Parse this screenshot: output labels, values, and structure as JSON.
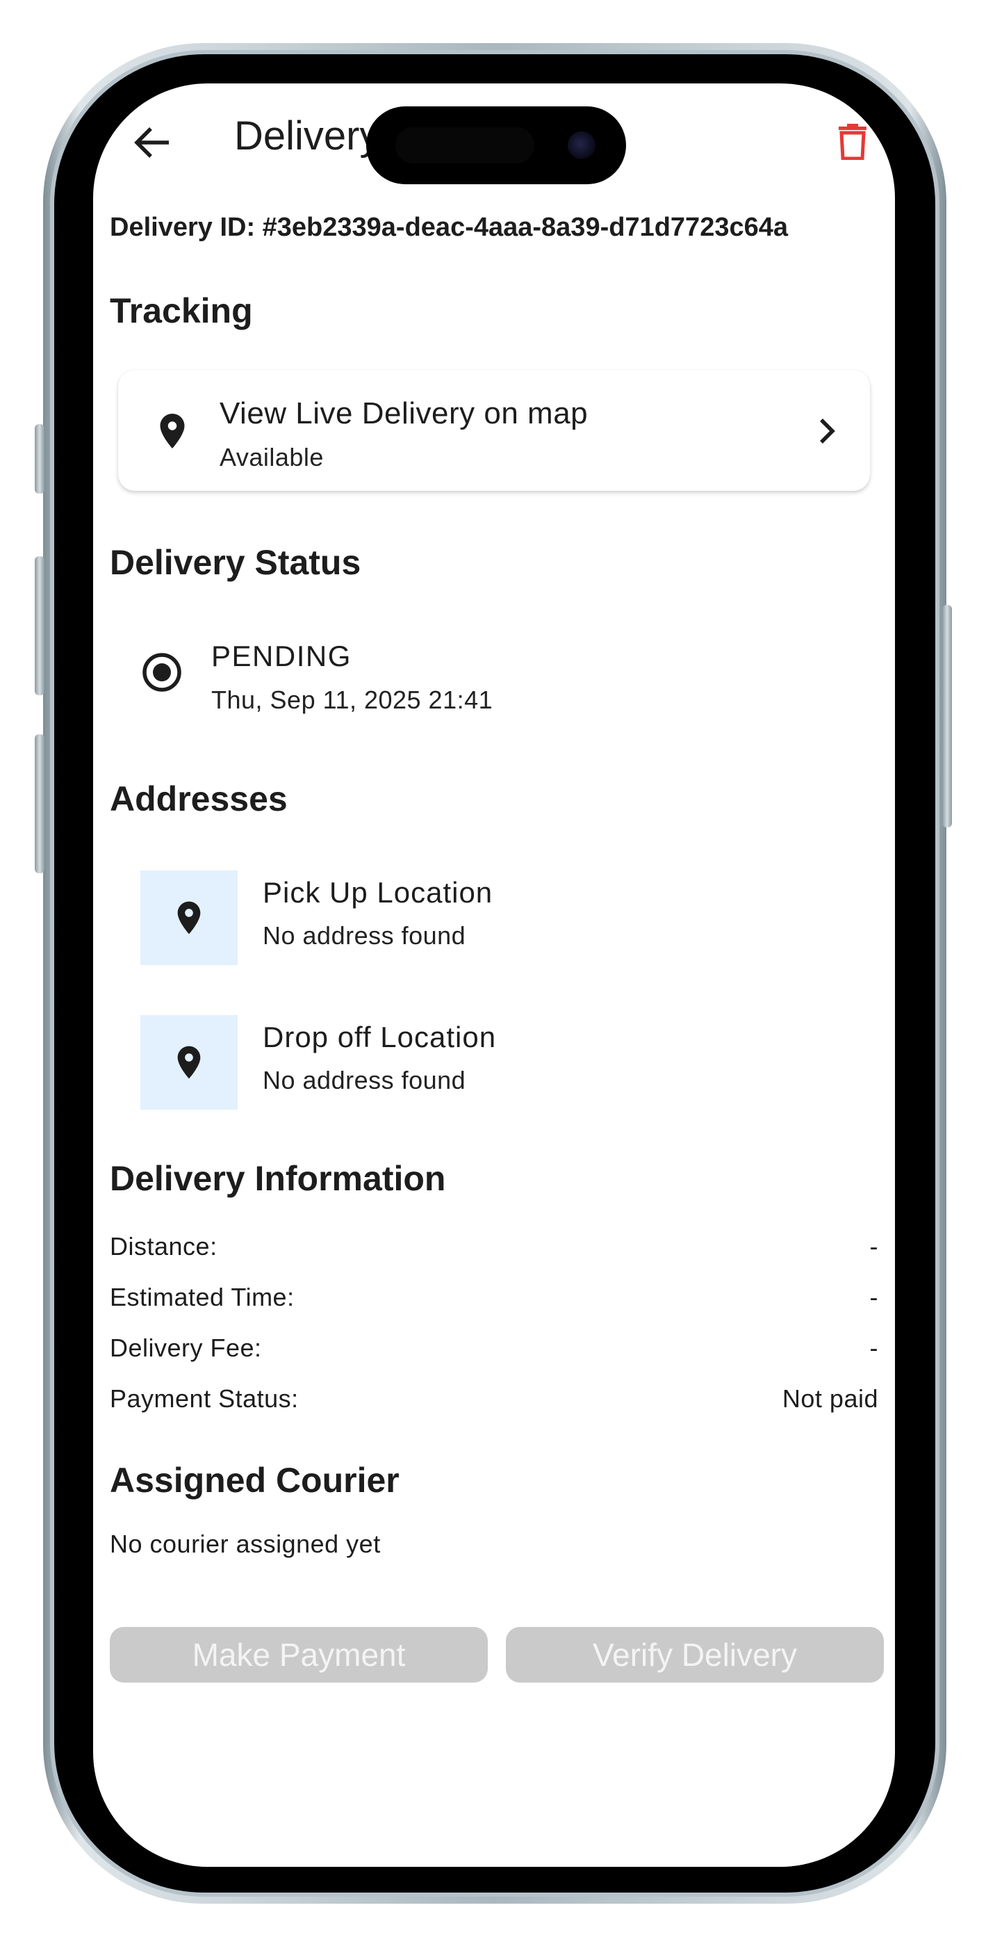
{
  "appbar": {
    "title": "Delivery Details",
    "back_icon": "arrow-back-icon",
    "delete_icon": "trash-icon",
    "delete_color": "#e53935"
  },
  "delivery_id": "Delivery ID: #3eb2339a-deac-4aaa-8a39-d71d7723c64a",
  "tracking": {
    "section_title": "Tracking",
    "card_title": "View Live Delivery on map",
    "card_subtitle": "Available",
    "icon": "map-pin-icon",
    "chevron_icon": "chevron-right-icon"
  },
  "status": {
    "section_title": "Delivery Status",
    "value": "PENDING",
    "timestamp": "Thu, Sep 11, 2025 21:41",
    "icon": "radio-selected-icon"
  },
  "addresses": {
    "section_title": "Addresses",
    "tile_color": "#e3f0fd",
    "items": [
      {
        "title": "Pick Up Location",
        "subtitle": "No address found",
        "icon": "map-pin-icon"
      },
      {
        "title": "Drop off Location",
        "subtitle": "No address found",
        "icon": "map-pin-icon"
      }
    ]
  },
  "info": {
    "section_title": "Delivery Information",
    "rows": [
      {
        "label": "Distance:",
        "value": "-"
      },
      {
        "label": "Estimated Time:",
        "value": "-"
      },
      {
        "label": "Delivery Fee:",
        "value": "-"
      },
      {
        "label": "Payment Status:",
        "value": "Not paid"
      }
    ]
  },
  "courier": {
    "section_title": "Assigned Courier",
    "text": "No courier assigned yet"
  },
  "actions": {
    "make_payment": "Make Payment",
    "verify_delivery": "Verify Delivery",
    "disabled_color": "#cacaca"
  }
}
